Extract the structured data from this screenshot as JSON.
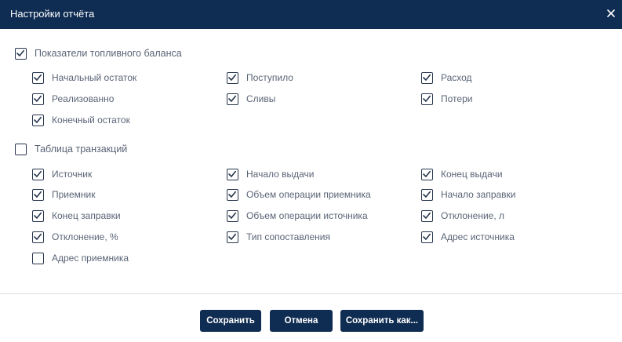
{
  "dialog": {
    "title": "Настройки отчёта"
  },
  "sections": {
    "fuel": {
      "label": "Показатели топливного баланса",
      "checked": true,
      "items": [
        {
          "label": "Начальный остаток",
          "checked": true
        },
        {
          "label": "Поступило",
          "checked": true
        },
        {
          "label": "Расход",
          "checked": true
        },
        {
          "label": "Реализованно",
          "checked": true
        },
        {
          "label": "Сливы",
          "checked": true
        },
        {
          "label": "Потери",
          "checked": true
        },
        {
          "label": "Конечный остаток",
          "checked": true
        }
      ]
    },
    "transactions": {
      "label": "Таблица транзакций",
      "checked": false,
      "items": [
        {
          "label": "Источник",
          "checked": true
        },
        {
          "label": "Начало выдачи",
          "checked": true
        },
        {
          "label": "Конец выдачи",
          "checked": true
        },
        {
          "label": "Приемник",
          "checked": true
        },
        {
          "label": "Объем операции приемника",
          "checked": true
        },
        {
          "label": "Начало заправки",
          "checked": true
        },
        {
          "label": "Конец заправки",
          "checked": true
        },
        {
          "label": "Объем операции источника",
          "checked": true
        },
        {
          "label": "Отклонение, л",
          "checked": true
        },
        {
          "label": "Отклонение, %",
          "checked": true
        },
        {
          "label": "Тип сопоставления",
          "checked": true
        },
        {
          "label": "Адрес источника",
          "checked": true
        },
        {
          "label": "Адрес приемника",
          "checked": false
        }
      ]
    }
  },
  "buttons": {
    "save": "Сохранить",
    "cancel": "Отмена",
    "save_as": "Сохранить как..."
  },
  "colors": {
    "header_bg": "#0f2c52",
    "button_bg": "#0f2c52",
    "checkbox_border": "#27364d"
  }
}
